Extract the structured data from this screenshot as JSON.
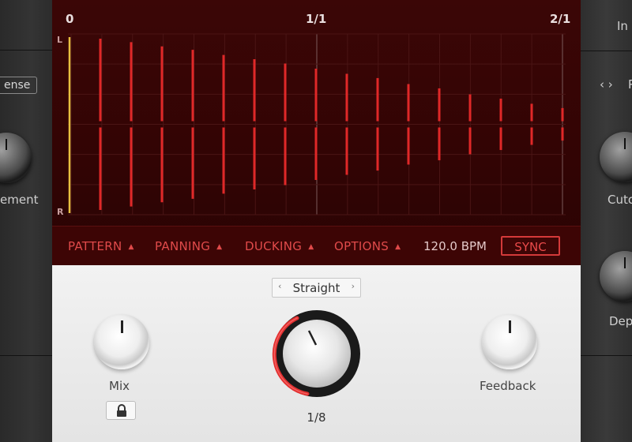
{
  "left_panel": {
    "sense_button": "ense",
    "knob_label": "ement"
  },
  "right_panel": {
    "in_label": "In",
    "nav_arrows": "‹ ›",
    "nav_suffix": "P",
    "cutoff_label": "Cuto",
    "depth_label": "Dep"
  },
  "timeline": {
    "start": "0",
    "middle": "1/1",
    "end": "2/1",
    "channel_left": "L",
    "channel_right": "R"
  },
  "pattern": {
    "description": "Delay echo taps, amplitude as fraction of full height",
    "taps": [
      1.0,
      0.96,
      0.91,
      0.87,
      0.81,
      0.76,
      0.71,
      0.65,
      0.59,
      0.54,
      0.47,
      0.42,
      0.35,
      0.3,
      0.24,
      0.19
    ]
  },
  "bottom_bar": {
    "pattern_label": "PATTERN",
    "panning_label": "PANNING",
    "ducking_label": "DUCKING",
    "options_label": "OPTIONS",
    "bpm": "120.0 BPM",
    "sync_label": "SYNC"
  },
  "controls": {
    "mode_selector": "Straight",
    "mix_label": "Mix",
    "feedback_label": "Feedback",
    "time_value": "1/8"
  },
  "colors": {
    "accent": "#e03a3a",
    "editor_bg": "#360505"
  }
}
